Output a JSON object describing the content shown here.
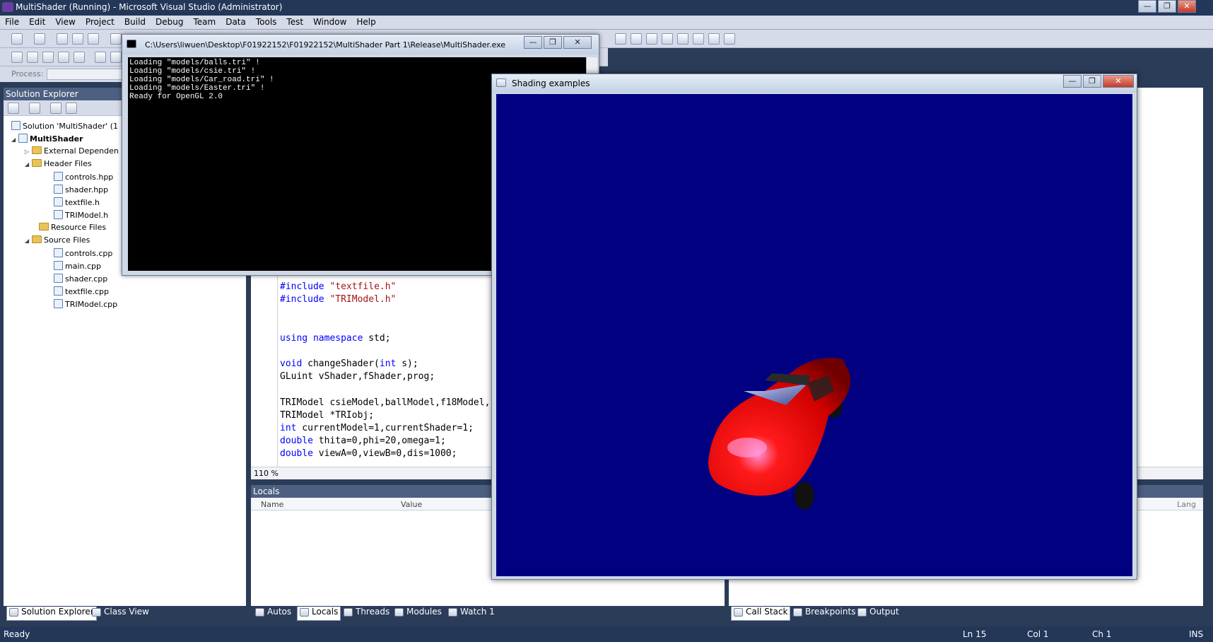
{
  "window": {
    "title": "MultiShader (Running) - Microsoft Visual Studio (Administrator)",
    "min_glyph": "—",
    "max_glyph": "❐",
    "close_glyph": "✕"
  },
  "menu": [
    "File",
    "Edit",
    "View",
    "Project",
    "Build",
    "Debug",
    "Team",
    "Data",
    "Tools",
    "Test",
    "Window",
    "Help"
  ],
  "process": {
    "label": "Process:"
  },
  "solution_explorer": {
    "title": "Solution Explorer",
    "solution": "Solution 'MultiShader' (1",
    "project": "MultiShader",
    "external": "External Dependen",
    "header_folder": "Header Files",
    "headers": [
      "controls.hpp",
      "shader.hpp",
      "textfile.h",
      "TRIModel.h"
    ],
    "resource_folder": "Resource Files",
    "source_folder": "Source Files",
    "sources": [
      "controls.cpp",
      "main.cpp",
      "shader.cpp",
      "textfile.cpp",
      "TRIModel.cpp"
    ]
  },
  "editor": {
    "zoom": "110 %",
    "lines": [
      {
        "pp": "#include",
        "str": " \"textfile.h\""
      },
      {
        "pp": "#include",
        "str": " \"TRIModel.h\""
      },
      {
        "blank": true
      },
      {
        "blank": true
      },
      {
        "kw": "using namespace",
        "rest": " std;"
      },
      {
        "blank": true
      },
      {
        "kw": "void",
        "rest": " changeShader(",
        "kw2": "int",
        "rest2": " s);"
      },
      {
        "rest": "GLuint vShader,fShader,prog;"
      },
      {
        "blank": true
      },
      {
        "rest": "TRIModel csieModel,ballModel,f18Model,"
      },
      {
        "rest": "TRIModel *TRIobj;"
      },
      {
        "kw": "int",
        "rest": " currentModel=1,currentShader=1;"
      },
      {
        "kw": "double",
        "rest": " thita=0,phi=20,omega=1;"
      },
      {
        "kw": "double",
        "rest": " viewA=0,viewB=0,dis=1000;"
      }
    ]
  },
  "locals": {
    "title": "Locals",
    "col_name": "Name",
    "col_value": "Value",
    "col_lang": "Lang"
  },
  "bottom_tabs_left": [
    "Solution Explorer",
    "Class View"
  ],
  "bottom_tabs_mid": [
    "Autos",
    "Locals",
    "Threads",
    "Modules",
    "Watch 1"
  ],
  "bottom_tabs_right": [
    "Call Stack",
    "Breakpoints",
    "Output"
  ],
  "status": {
    "ready": "Ready",
    "ln": "Ln 15",
    "col": "Col 1",
    "ch": "Ch 1",
    "ins": "INS"
  },
  "console": {
    "title": "C:\\Users\\liwuen\\Desktop\\F01922152\\F01922152\\MultiShader Part 1\\Release\\MultiShader.exe",
    "output": "Loading \"models/balls.tri\" !\nLoading \"models/csie.tri\" !\nLoading \"models/Car_road.tri\" !\nLoading \"models/Easter.tri\" !\nReady for OpenGL 2.0"
  },
  "glwindow": {
    "title": "Shading examples",
    "background": "#000080",
    "model_color": "#e00000"
  }
}
